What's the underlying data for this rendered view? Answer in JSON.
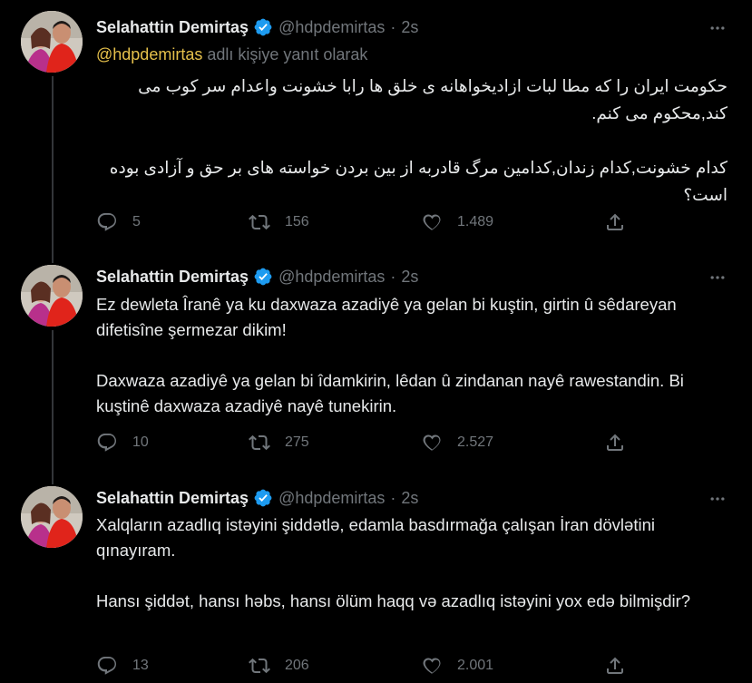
{
  "colors": {
    "background": "#000000",
    "text": "#e7e9ea",
    "secondary": "#71767b",
    "verified": "#1d9bf0",
    "mention": "#e5c04b"
  },
  "tweets": [
    {
      "name": "Selahattin Demirtaş",
      "handle": "@hdpdemirtas",
      "dot": "·",
      "time": "2s",
      "reply_to": {
        "mention": "@hdpdemirtas",
        "suffix": "adlı kişiye yanıt olarak"
      },
      "paragraphs": [
        "حکومت ایران را که مطا لبات ازادیخواهانه ی خلق ها رابا خشونت واعدام سر کوب می کند,محکوم می کنم.",
        "کدام خشونت,کدام زندان,کدامین مرگ قادربه از بین بردن خواسته های بر حق و آزادی بوده است؟"
      ],
      "replies": "5",
      "retweets": "156",
      "likes": "1.489"
    },
    {
      "name": "Selahattin Demirtaş",
      "handle": "@hdpdemirtas",
      "dot": "·",
      "time": "2s",
      "paragraphs": [
        "Ez dewleta Îranê ya ku daxwaza azadiyê ya gelan bi kuştin, girtin û sêdareyan difetisîne şermezar dikim!",
        "Daxwaza azadiyê ya gelan bi îdamkirin, lêdan û zindanan nayê rawestandin. Bi kuştinê daxwaza azadiyê nayê tunekirin."
      ],
      "replies": "10",
      "retweets": "275",
      "likes": "2.527"
    },
    {
      "name": "Selahattin Demirtaş",
      "handle": "@hdpdemirtas",
      "dot": "·",
      "time": "2s",
      "paragraphs": [
        "Xalqların azadlıq istəyini şiddətlə, edamla basdırmağa çalışan İran dövlətini qınayıram.",
        "Hansı şiddət, hansı həbs, hansı ölüm haqq və azadlıq istəyini yox edə bilmişdir?"
      ],
      "replies": "13",
      "retweets": "206",
      "likes": "2.001"
    }
  ]
}
